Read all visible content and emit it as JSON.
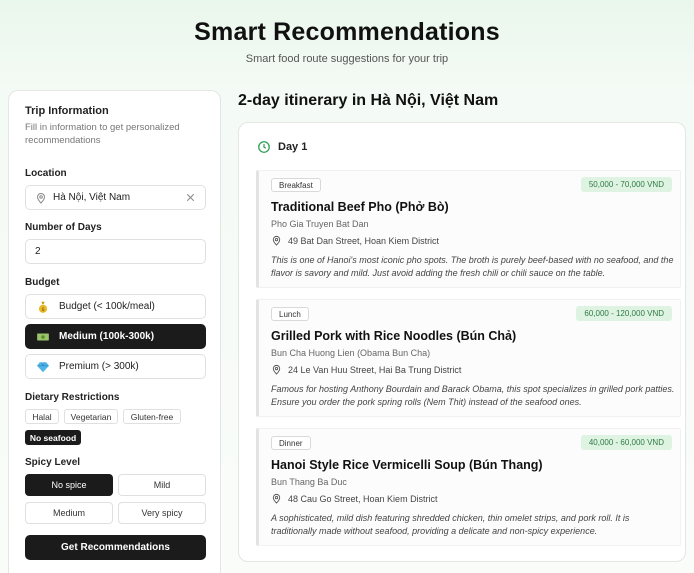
{
  "header": {
    "title": "Smart Recommendations",
    "subtitle": "Smart food route suggestions for your trip"
  },
  "sidebar": {
    "title": "Trip Information",
    "description": "Fill in information to get personalized recommendations",
    "location": {
      "label": "Location",
      "value": "Hà Nội, Việt Nam"
    },
    "days": {
      "label": "Number of Days",
      "value": "2"
    },
    "budget": {
      "label": "Budget",
      "options": [
        {
          "label": "Budget (< 100k/meal)",
          "icon": "money-bag-icon",
          "selected": false
        },
        {
          "label": "Medium (100k-300k)",
          "icon": "banknote-icon",
          "selected": true
        },
        {
          "label": "Premium (> 300k)",
          "icon": "diamond-icon",
          "selected": false
        }
      ]
    },
    "dietary": {
      "label": "Dietary Restrictions",
      "options": [
        {
          "label": "Halal",
          "selected": false
        },
        {
          "label": "Vegetarian",
          "selected": false
        },
        {
          "label": "Gluten-free",
          "selected": false
        },
        {
          "label": "No seafood",
          "selected": true
        }
      ]
    },
    "spicy": {
      "label": "Spicy Level",
      "options": [
        {
          "label": "No spice",
          "selected": true
        },
        {
          "label": "Mild",
          "selected": false
        },
        {
          "label": "Medium",
          "selected": false
        },
        {
          "label": "Very spicy",
          "selected": false
        }
      ]
    },
    "submit_label": "Get Recommendations"
  },
  "main": {
    "itinerary_title": "2-day itinerary in Hà Nội, Việt Nam",
    "day": {
      "label": "Day 1",
      "meals": [
        {
          "tag": "Breakfast",
          "price": "50,000 - 70,000 VND",
          "name": "Traditional Beef Pho (Phở Bò)",
          "place": "Pho Gia Truyen Bat Dan",
          "address": "49 Bat Dan Street, Hoan Kiem District",
          "description": "This is one of Hanoi's most iconic pho spots. The broth is purely beef-based with no seafood, and the flavor is savory and mild. Just avoid adding the fresh chili or chili sauce on the table."
        },
        {
          "tag": "Lunch",
          "price": "60,000 - 120,000 VND",
          "name": "Grilled Pork with Rice Noodles (Bún Chả)",
          "place": "Bun Cha Huong Lien (Obama Bun Cha)",
          "address": "24 Le Van Huu Street, Hai Ba Trung District",
          "description": "Famous for hosting Anthony Bourdain and Barack Obama, this spot specializes in grilled pork patties. Ensure you order the pork spring rolls (Nem Thit) instead of the seafood ones."
        },
        {
          "tag": "Dinner",
          "price": "40,000 - 60,000 VND",
          "name": "Hanoi Style Rice Vermicelli Soup (Bún Thang)",
          "place": "Bun Thang Ba Duc",
          "address": "48 Cau Go Street, Hoan Kiem District",
          "description": "A sophisticated, mild dish featuring shredded chicken, thin omelet strips, and pork roll. It is traditionally made without seafood, providing a delicate and non-spicy experience."
        }
      ]
    }
  },
  "colors": {
    "accent_green": "#2f9e55",
    "price_bg": "#dff3e3",
    "price_text": "#2f7a43",
    "selected_bg": "#1b1b1b"
  }
}
